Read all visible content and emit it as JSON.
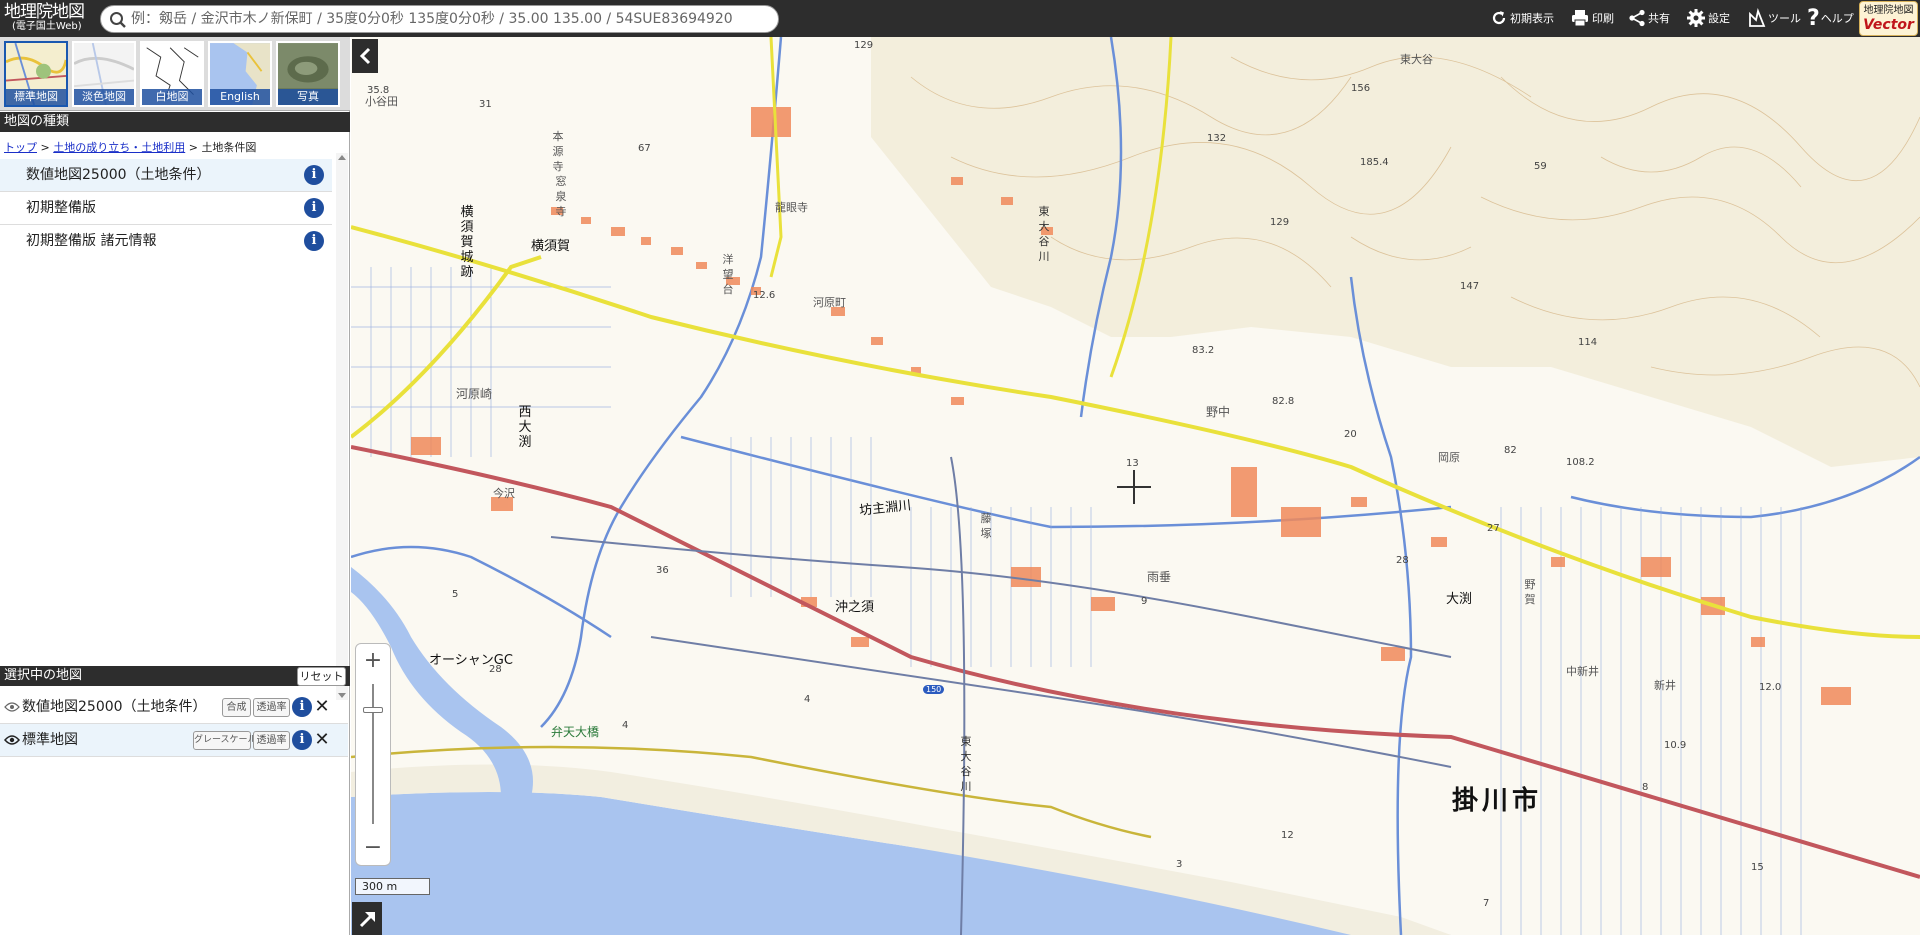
{
  "header": {
    "logo_line1": "地理院地図",
    "logo_line2": "(電子国土Web)",
    "search_placeholder": "例：剱岳 / 金沢市木ノ新保町 / 35度0分0秒 135度0分0秒 / 35.00 135.00 / 54SUE83694920",
    "tools": {
      "reset_view": "初期表示",
      "print": "印刷",
      "share": "共有",
      "settings": "設定",
      "tools": "ツール",
      "help": "ヘルプ"
    },
    "vector_badge_line1": "地理院地図",
    "vector_badge_line2": "Vector"
  },
  "thumbnails": [
    {
      "label": "標準地図",
      "active": true
    },
    {
      "label": "淡色地図",
      "active": false
    },
    {
      "label": "白地図",
      "active": false
    },
    {
      "label": "English",
      "active": false
    },
    {
      "label": "写真",
      "active": false
    }
  ],
  "map_types": {
    "heading": "地図の種類",
    "breadcrumb": {
      "top": "トップ",
      "sep1": " > ",
      "parent": "土地の成り立ち・土地利用",
      "sep2": " > ",
      "current": "土地条件図"
    },
    "items": [
      {
        "label": "数値地図25000（土地条件）",
        "selected": true
      },
      {
        "label": "初期整備版",
        "selected": false
      },
      {
        "label": "初期整備版 諸元情報",
        "selected": false
      }
    ]
  },
  "selected_maps": {
    "heading": "選択中の地図",
    "reset_label": "リセット",
    "layers": [
      {
        "name": "数値地図25000（土地条件）",
        "btn1": "合成",
        "btn2": "透過率"
      },
      {
        "name": "標準地図",
        "btn1": "グレースケール",
        "btn2": "透過率"
      }
    ]
  },
  "map": {
    "labels": {
      "kakegawa": "掛川市",
      "yokosuka": "横須賀",
      "yokosuka_castle": "横須賀城跡",
      "bozugawa": "坊主淵川",
      "okinosu": "沖之須",
      "oceangc": "オーシャンGC",
      "bentenbashi": "弁天大橋",
      "nishiobuchi": "西大渕",
      "obuchi": "大渕",
      "kawarazaki": "河原崎",
      "kawaramachi": "河原町",
      "nonaka": "野中",
      "ameagari": "雨垂",
      "imasawa": "今沢",
      "okahara": "岡原",
      "nakashinden": "中新井",
      "ryugenji": "龍眼寺",
      "hongenji": "本源寺",
      "kusenji": "窓泉寺",
      "yosuidai": "洋望台",
      "higashiotani": "東大谷川",
      "higashiotani2": "東大谷",
      "higashiotaniriver2": "東大谷川",
      "nonakaka": "野賀",
      "ogasa": "小谷田",
      "fujitsuka": "藤塚",
      "shinden": "新井",
      "route150": "150"
    },
    "spot_heights": [
      "35.8",
      "31",
      "67",
      "129",
      "156",
      "132",
      "185.4",
      "59",
      "129",
      "147",
      "114",
      "83.2",
      "82.8",
      "20",
      "82",
      "108.2",
      "12.6",
      "28",
      "27",
      "12.0",
      "10.9",
      "28",
      "4",
      "12",
      "3",
      "7",
      "15",
      "8",
      "9",
      "5",
      "13",
      "36",
      "4"
    ],
    "scale_label": "300 m"
  },
  "colors": {
    "header_bg": "#2d2d2d",
    "accent_blue": "#1f4e9e",
    "sea": "#a9c4ef",
    "road_yellow": "#e9e13b",
    "road_red": "#c2575d",
    "building": "#f08a5b"
  }
}
